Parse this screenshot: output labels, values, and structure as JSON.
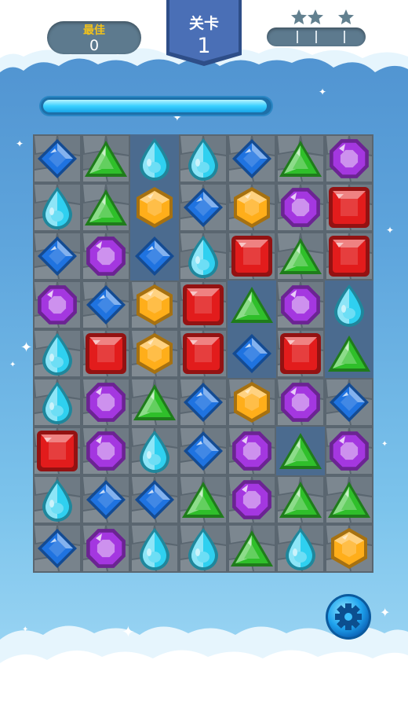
{
  "hud": {
    "best_label": "最佳",
    "best_score": "0",
    "level_label": "关卡",
    "level_number": "1",
    "stars_total": 3,
    "stars_earned": 0,
    "star_progress": 0,
    "time_remaining": 0.99
  },
  "colors": {
    "blue": "#1f73e0",
    "cyan": "#2fd0f0",
    "green": "#2fbf2a",
    "orange": "#ffae1a",
    "purple": "#a437e0",
    "red": "#e21c1c"
  },
  "board": {
    "rows": 9,
    "cols": 7,
    "tiles": [
      [
        1,
        1,
        0,
        1,
        1,
        1,
        1
      ],
      [
        1,
        1,
        0,
        1,
        1,
        1,
        1
      ],
      [
        1,
        1,
        0,
        1,
        1,
        1,
        1
      ],
      [
        1,
        1,
        1,
        1,
        0,
        1,
        0
      ],
      [
        1,
        1,
        1,
        1,
        0,
        1,
        0
      ],
      [
        1,
        1,
        1,
        1,
        1,
        1,
        1
      ],
      [
        1,
        1,
        1,
        1,
        1,
        0,
        1
      ],
      [
        1,
        1,
        1,
        1,
        1,
        1,
        1
      ],
      [
        1,
        1,
        1,
        1,
        1,
        1,
        1
      ]
    ],
    "grid": [
      [
        "blue-diamond",
        "green-triangle",
        "cyan-drop",
        "cyan-drop",
        "blue-diamond",
        "green-triangle",
        "purple-octagon"
      ],
      [
        "cyan-drop",
        "green-triangle",
        "orange-hexagon",
        "blue-diamond",
        "orange-hexagon",
        "purple-octagon",
        "red-square"
      ],
      [
        "blue-diamond",
        "purple-octagon",
        "blue-diamond",
        "cyan-drop",
        "red-square",
        "green-triangle",
        "red-square"
      ],
      [
        "purple-octagon",
        "blue-diamond",
        "orange-hexagon",
        "red-square",
        "green-triangle",
        "purple-octagon",
        "cyan-drop"
      ],
      [
        "cyan-drop",
        "red-square",
        "orange-hexagon",
        "red-square",
        "blue-diamond",
        "red-square",
        "green-triangle"
      ],
      [
        "cyan-drop",
        "purple-octagon",
        "green-triangle",
        "blue-diamond",
        "orange-hexagon",
        "purple-octagon",
        "blue-diamond"
      ],
      [
        "red-square",
        "purple-octagon",
        "cyan-drop",
        "blue-diamond",
        "purple-octagon",
        "green-triangle",
        "purple-octagon"
      ],
      [
        "cyan-drop",
        "blue-diamond",
        "blue-diamond",
        "green-triangle",
        "purple-octagon",
        "green-triangle",
        "green-triangle"
      ],
      [
        "blue-diamond",
        "purple-octagon",
        "cyan-drop",
        "cyan-drop",
        "green-triangle",
        "cyan-drop",
        "orange-hexagon"
      ]
    ]
  },
  "settings": {
    "icon": "gear-icon"
  }
}
